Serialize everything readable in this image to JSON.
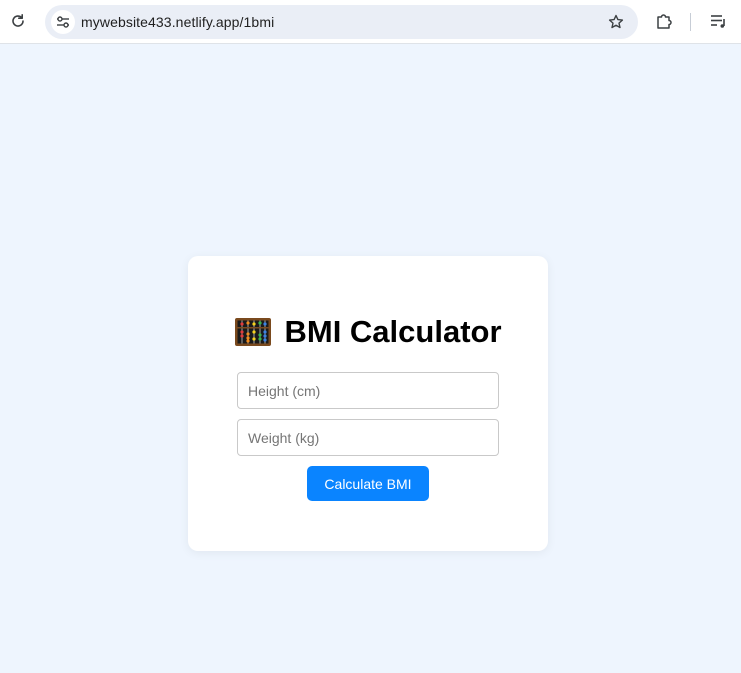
{
  "browser": {
    "url": "mywebsite433.netlify.app/1bmi",
    "icons": {
      "reload": "reload-icon",
      "site_info": "tune-icon",
      "bookmark": "star-icon",
      "extensions": "puzzle-icon",
      "media": "playlist-icon"
    }
  },
  "page": {
    "background": "#eef5fe",
    "card": {
      "title_emoji_icon": "abacus-icon",
      "title": "BMI Calculator",
      "height_placeholder": "Height (cm)",
      "height_value": "",
      "weight_placeholder": "Weight (kg)",
      "weight_value": "",
      "button_label": "Calculate BMI",
      "button_color": "#0a84ff"
    }
  }
}
